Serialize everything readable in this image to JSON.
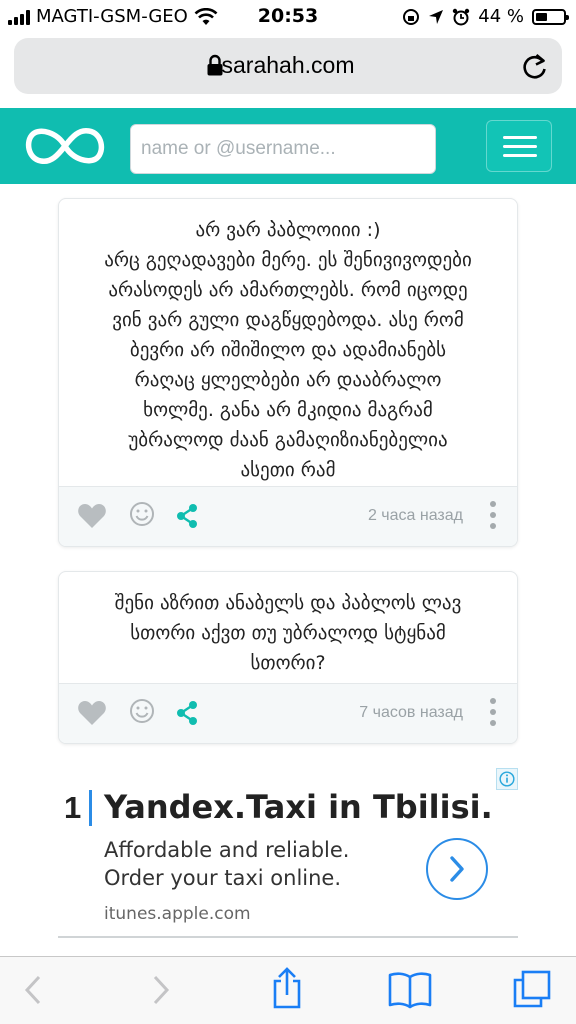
{
  "status_bar": {
    "carrier": "MAGTI-GSM-GEO",
    "time": "20:53",
    "battery_percent": "44 %",
    "battery_level": 0.44
  },
  "browser": {
    "url": "sarahah.com"
  },
  "header": {
    "search_placeholder": "name or @username..."
  },
  "messages": [
    {
      "text": "არ ვარ პაბლოიიი :)\nარც გეღადავები მერე. ეს შენივივოდები\nარასოდეს არ ამართლებს. რომ იცოდე\nვინ ვარ გული დაგწყდებოდა. ასე რომ\nბევრი არ იშიშილო და ადამიანებს\nრაღაც ყლელბები არ დააბრალო\nხოლმე. განა არ მკიდია მაგრამ\nუბრალოდ ძაან გამაღიზიანებელია\nასეთი რამ",
      "time": "2 часа назад"
    },
    {
      "text": "შენი აზრით ანაბელს და პაბლოს ლავ\nსთორი აქვთ თუ უბრალოდ სტყნამ\nსთორი?",
      "time": "7 часов назад"
    }
  ],
  "ad": {
    "number": "1",
    "title": "Yandex.Taxi in Tbilisi.",
    "body": "Affordable and reliable. Order your taxi online.",
    "domain": "itunes.apple.com",
    "accent_color": "#2b8ce6"
  },
  "colors": {
    "brand": "#10bdb0",
    "ios_blue": "#1a7ef5"
  },
  "icons": [
    "signal-icon",
    "wifi-icon",
    "lock-icon",
    "reload-icon",
    "logo-icon",
    "heart-icon",
    "smile-icon",
    "share-icon",
    "more-icon",
    "info-icon",
    "chevron-right-icon",
    "back-icon",
    "forward-icon",
    "share-toolbar-icon",
    "bookmarks-icon",
    "tabs-icon"
  ]
}
